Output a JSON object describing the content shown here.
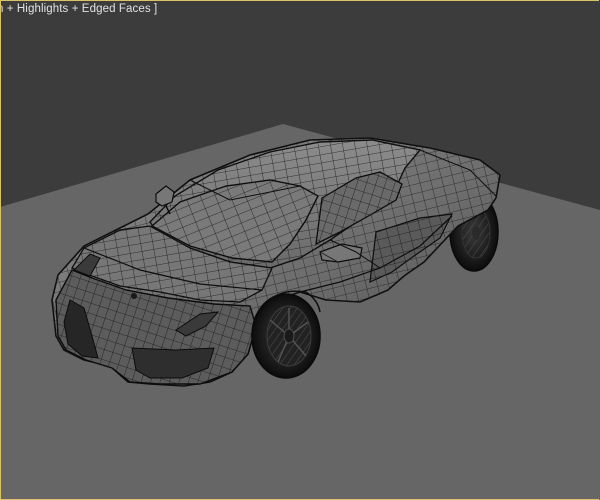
{
  "viewport": {
    "shading_label": "n + Highlights + Edged Faces ]",
    "background_color": "#3c3c3c",
    "ground_color": "#666666",
    "wire_color": "#161616",
    "active_border_color": "#d9c26a"
  },
  "model": {
    "object": "car-mesh",
    "display_mode": "smooth-highlights-edged-faces"
  }
}
